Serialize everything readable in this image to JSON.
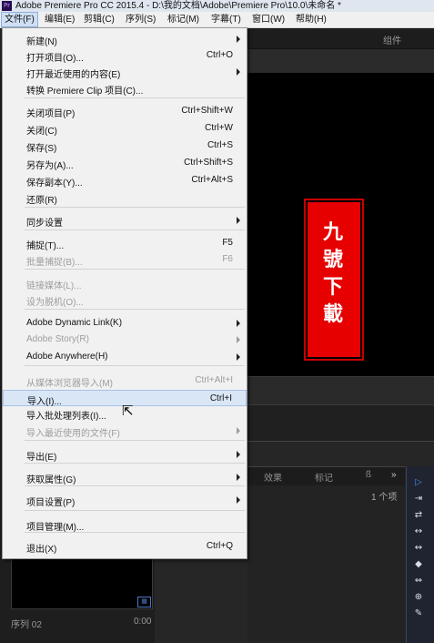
{
  "window": {
    "title": "Adobe Premiere Pro CC 2015.4 - D:\\我的文档\\Adobe\\Premiere Pro\\10.0\\未命名 *",
    "app_icon": "Pr"
  },
  "menubar": [
    "文件(F)",
    "编辑(E)",
    "剪辑(C)",
    "序列(S)",
    "标记(M)",
    "字幕(T)",
    "窗口(W)",
    "帮助(H)"
  ],
  "file_menu": [
    {
      "label": "新建(N)",
      "shortcut": "",
      "submenu": true,
      "enabled": true
    },
    {
      "label": "打开项目(O)...",
      "shortcut": "Ctrl+O",
      "submenu": false,
      "enabled": true
    },
    {
      "label": "打开最近使用的内容(E)",
      "shortcut": "",
      "submenu": true,
      "enabled": true
    },
    {
      "label": "转换 Premiere Clip 项目(C)...",
      "shortcut": "",
      "submenu": false,
      "enabled": true
    },
    {
      "label": "关闭项目(P)",
      "shortcut": "Ctrl+Shift+W",
      "submenu": false,
      "enabled": true
    },
    {
      "label": "关闭(C)",
      "shortcut": "Ctrl+W",
      "submenu": false,
      "enabled": true
    },
    {
      "label": "保存(S)",
      "shortcut": "Ctrl+S",
      "submenu": false,
      "enabled": true
    },
    {
      "label": "另存为(A)...",
      "shortcut": "Ctrl+Shift+S",
      "submenu": false,
      "enabled": true
    },
    {
      "label": "保存副本(Y)...",
      "shortcut": "Ctrl+Alt+S",
      "submenu": false,
      "enabled": true
    },
    {
      "label": "还原(R)",
      "shortcut": "",
      "submenu": false,
      "enabled": true
    },
    {
      "label": "同步设置",
      "shortcut": "",
      "submenu": true,
      "enabled": true
    },
    {
      "label": "捕捉(T)...",
      "shortcut": "F5",
      "submenu": false,
      "enabled": true
    },
    {
      "label": "批量捕捉(B)...",
      "shortcut": "F6",
      "submenu": false,
      "enabled": false
    },
    {
      "label": "链接媒体(L)...",
      "shortcut": "",
      "submenu": false,
      "enabled": false
    },
    {
      "label": "设为脱机(O)...",
      "shortcut": "",
      "submenu": false,
      "enabled": false
    },
    {
      "label": "Adobe Dynamic Link(K)",
      "shortcut": "",
      "submenu": true,
      "enabled": true
    },
    {
      "label": "Adobe Story(R)",
      "shortcut": "",
      "submenu": true,
      "enabled": false
    },
    {
      "label": "Adobe Anywhere(H)",
      "shortcut": "",
      "submenu": true,
      "enabled": true
    },
    {
      "label": "从媒体浏览器导入(M)",
      "shortcut": "Ctrl+Alt+I",
      "submenu": false,
      "enabled": false
    },
    {
      "label": "导入(I)...",
      "shortcut": "Ctrl+I",
      "submenu": false,
      "enabled": true,
      "highlighted": true
    },
    {
      "label": "导入批处理列表(I)...",
      "shortcut": "",
      "submenu": false,
      "enabled": true
    },
    {
      "label": "导入最近使用的文件(F)",
      "shortcut": "",
      "submenu": true,
      "enabled": false
    },
    {
      "label": "导出(E)",
      "shortcut": "",
      "submenu": true,
      "enabled": true
    },
    {
      "label": "获取属性(G)",
      "shortcut": "",
      "submenu": true,
      "enabled": true
    },
    {
      "label": "项目设置(P)",
      "shortcut": "",
      "submenu": true,
      "enabled": true
    },
    {
      "label": "项目管理(M)...",
      "shortcut": "",
      "submenu": false,
      "enabled": true
    },
    {
      "label": "退出(X)",
      "shortcut": "Ctrl+Q",
      "submenu": false,
      "enabled": true
    }
  ],
  "panels": {
    "workspace_label": "组件",
    "tabs": [
      "效果",
      "标记",
      "ß",
      "»"
    ],
    "item_count": "1 个项",
    "sequence_name": "序列 02",
    "sequence_duration": "0:00"
  },
  "stamp": {
    "text": "九號下載",
    "color": "#e60000"
  },
  "tools": [
    "selection-icon",
    "track-select-icon",
    "ripple-edit-icon",
    "rolling-edit-icon",
    "rate-stretch-icon",
    "razor-icon",
    "slip-icon",
    "slide-icon",
    "pen-icon"
  ]
}
